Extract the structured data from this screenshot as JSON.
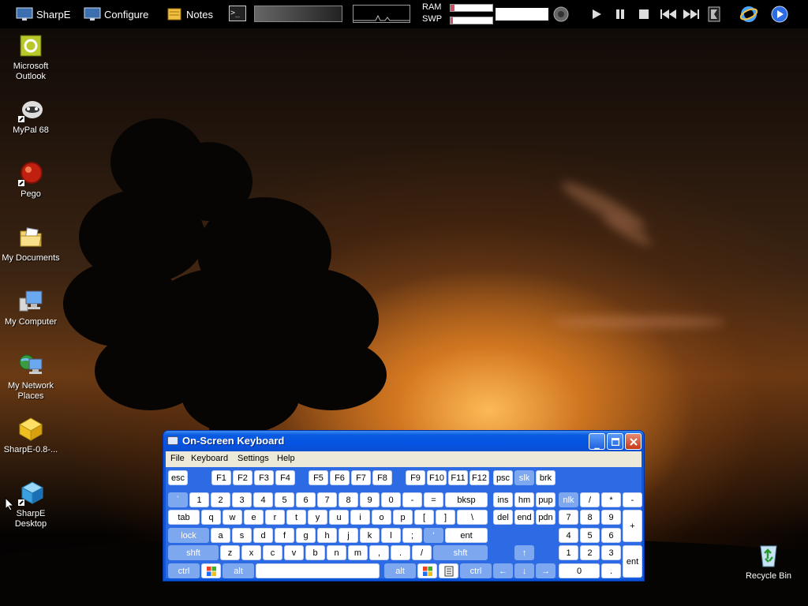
{
  "topbar": {
    "buttons": [
      {
        "label": "SharpE",
        "icon": "monitor-icon"
      },
      {
        "label": "Configure",
        "icon": "monitor-icon"
      },
      {
        "label": "Notes",
        "icon": "notepad-icon"
      }
    ],
    "terminal_glyph": ">_",
    "ram_label": "RAM",
    "swp_label": "SWP",
    "ram_usage": 0.1,
    "swp_usage": 0.05
  },
  "desktop_icons": [
    {
      "label": "Microsoft Outlook",
      "icon": "outlook-icon"
    },
    {
      "label": "MyPal 68",
      "icon": "mypal-icon"
    },
    {
      "label": "Pego",
      "icon": "pego-icon"
    },
    {
      "label": "My Documents",
      "icon": "folder-icon"
    },
    {
      "label": "My Computer",
      "icon": "computer-icon"
    },
    {
      "label": "My Network Places",
      "icon": "network-icon"
    },
    {
      "label": "SharpE-0.8-...",
      "icon": "package-icon"
    },
    {
      "label": "SharpE Desktop",
      "icon": "cube-icon"
    },
    {
      "label": "Recycle Bin",
      "icon": "recycle-bin-icon"
    }
  ],
  "osk": {
    "title": "On-Screen Keyboard",
    "menu": [
      "File",
      "Keyboard",
      "Settings",
      "Help"
    ],
    "keys": {
      "esc": "esc",
      "f1": "F1",
      "f2": "F2",
      "f3": "F3",
      "f4": "F4",
      "f5": "F5",
      "f6": "F6",
      "f7": "F7",
      "f8": "F8",
      "f9": "F9",
      "f10": "F10",
      "f11": "F11",
      "f12": "F12",
      "psc": "psc",
      "slk": "slk",
      "brk": "brk",
      "backtick": "`",
      "n1": "1",
      "n2": "2",
      "n3": "3",
      "n4": "4",
      "n5": "5",
      "n6": "6",
      "n7": "7",
      "n8": "8",
      "n9": "9",
      "n0": "0",
      "minus": "-",
      "equals": "=",
      "bksp": "bksp",
      "ins": "ins",
      "hm": "hm",
      "pup": "pup",
      "nlk": "nlk",
      "slash": "/",
      "star": "*",
      "npminus": "-",
      "tab": "tab",
      "q": "q",
      "w": "w",
      "e": "e",
      "r": "r",
      "t": "t",
      "y": "y",
      "u": "u",
      "i": "i",
      "o": "o",
      "p": "p",
      "lbracket": "[",
      "rbracket": "]",
      "backslash": "\\",
      "del": "del",
      "end": "end",
      "pdn": "pdn",
      "np7": "7",
      "np8": "8",
      "np9": "9",
      "npplus": "+",
      "lock": "lock",
      "a": "a",
      "s": "s",
      "d": "d",
      "f": "f",
      "g": "g",
      "h": "h",
      "j": "j",
      "k": "k",
      "l": "l",
      "semicolon": ";",
      "quote": "'",
      "ent": "ent",
      "np4": "4",
      "np5": "5",
      "np6": "6",
      "lshft": "shft",
      "z": "z",
      "x": "x",
      "c": "c",
      "v": "v",
      "b": "b",
      "n": "n",
      "m": "m",
      "comma": ",",
      "period": ".",
      "fslash": "/",
      "rshft": "shft",
      "up": "↑",
      "np1": "1",
      "np2": "2",
      "np3": "3",
      "npent": "ent",
      "lctrl": "ctrl",
      "lalt": "alt",
      "ralt": "alt",
      "rctrl": "ctrl",
      "left": "←",
      "down": "↓",
      "right": "→",
      "np0": "0",
      "npdot": "."
    }
  },
  "colors": {
    "xp_blue": "#0a55d8",
    "key_dim": "#7da7ee"
  }
}
